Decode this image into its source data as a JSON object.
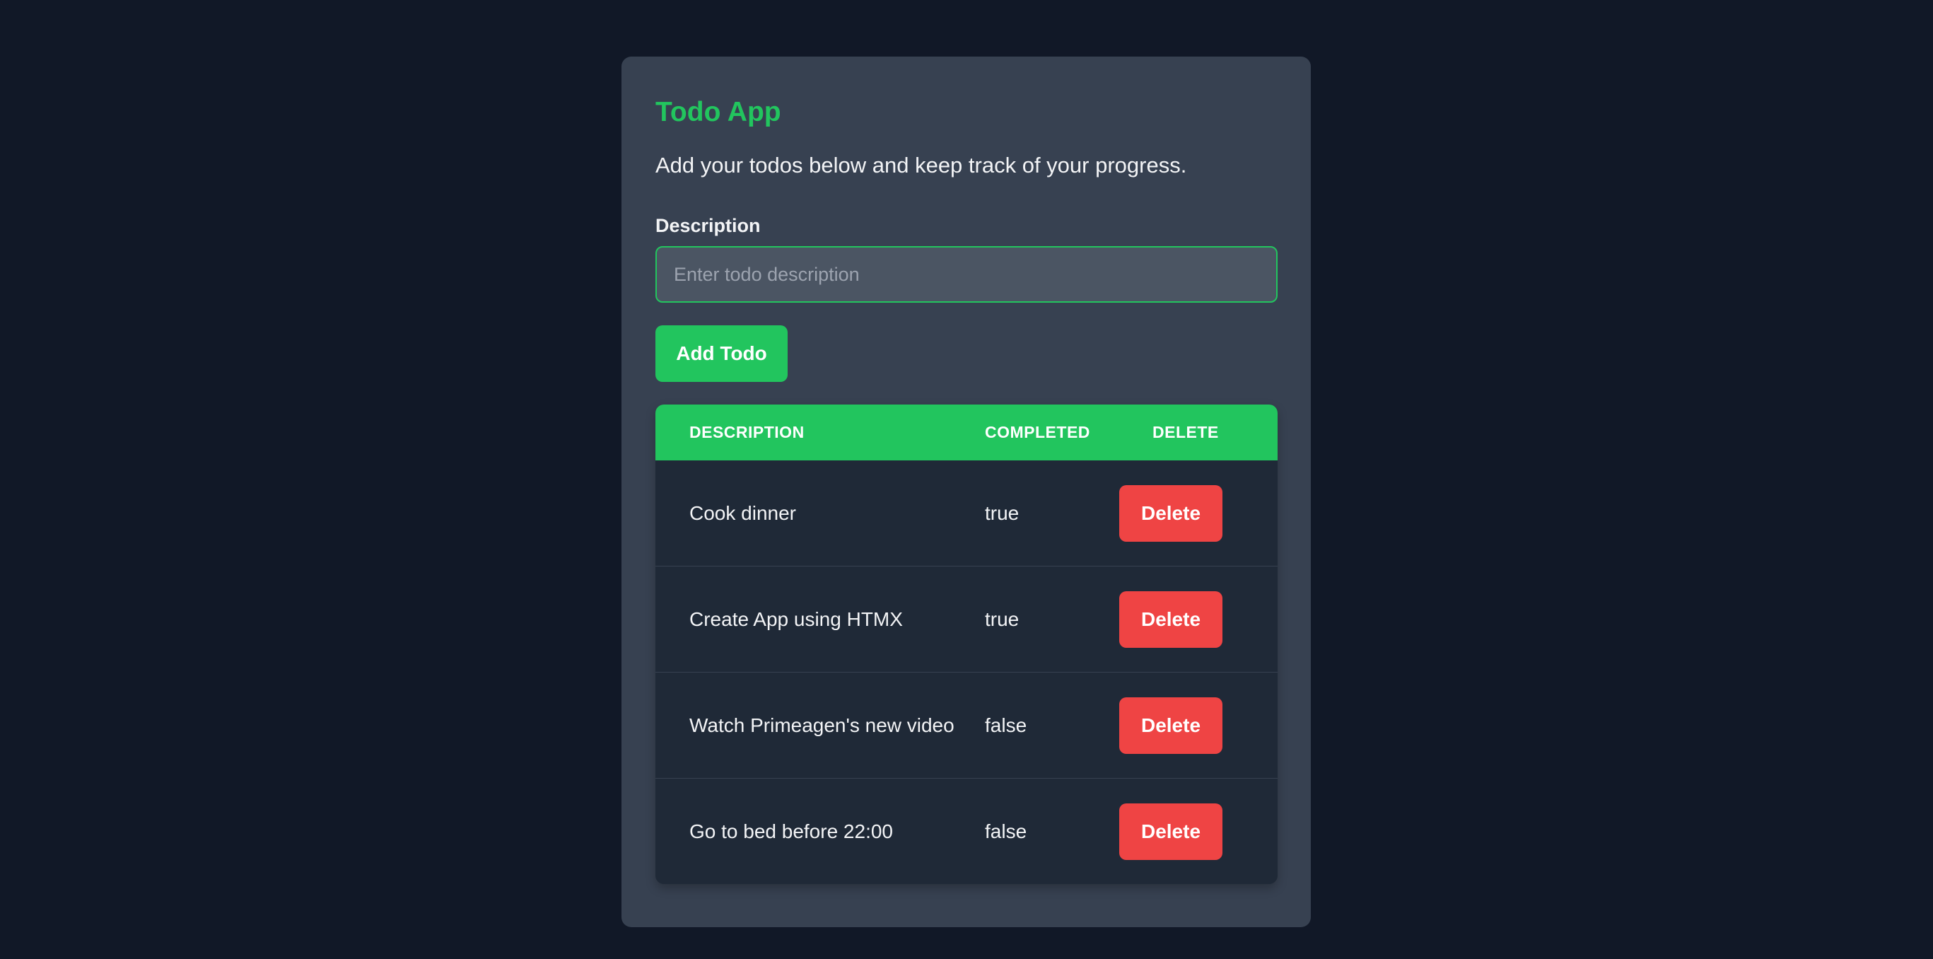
{
  "app": {
    "title": "Todo App",
    "subtitle": "Add your todos below and keep track of your progress."
  },
  "form": {
    "label": "Description",
    "value": "",
    "placeholder": "Enter todo description",
    "submit_label": "Add Todo"
  },
  "table": {
    "headers": {
      "description": "Description",
      "completed": "Completed",
      "delete": "Delete"
    },
    "rows": [
      {
        "description": "Cook dinner",
        "completed": "true",
        "action": "Delete"
      },
      {
        "description": "Create App using HTMX",
        "completed": "true",
        "action": "Delete"
      },
      {
        "description": "Watch Primeagen's new video",
        "completed": "false",
        "action": "Delete"
      },
      {
        "description": "Go to bed before 22:00",
        "completed": "false",
        "action": "Delete"
      }
    ]
  },
  "colors": {
    "background": "#111827",
    "card": "#374151",
    "accent": "#22c55e",
    "danger": "#ef4444",
    "table_body": "#1f2937",
    "input_bg": "#4b5563"
  }
}
